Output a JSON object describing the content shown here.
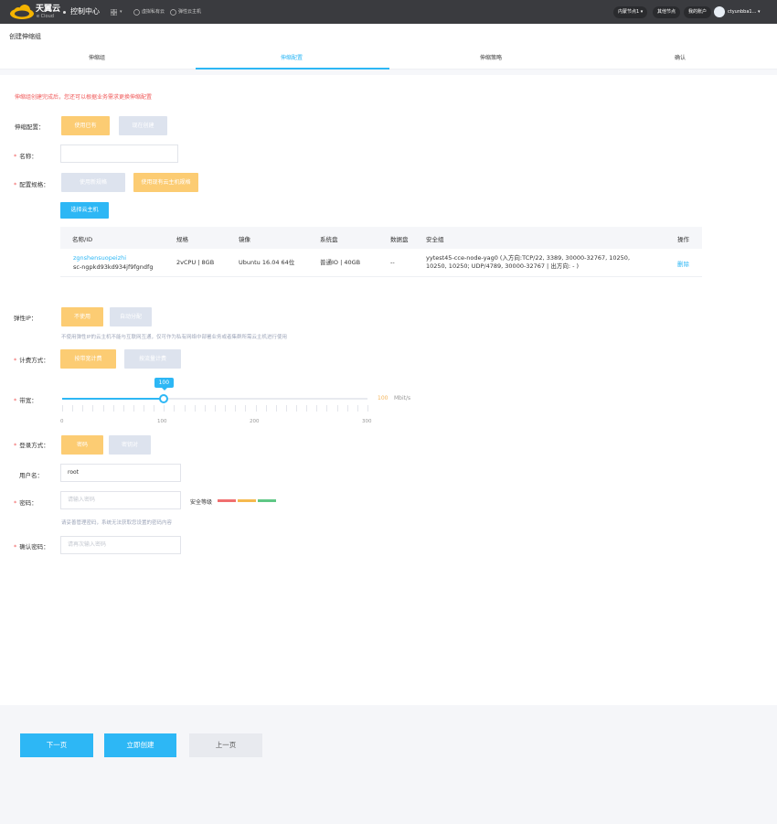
{
  "topbar": {
    "brand": "天翼云",
    "brand_sub": "e Cloud",
    "console": "控制中心",
    "links": [
      "虚拟私有云",
      "弹性云主机"
    ],
    "region": "内蒙节点1",
    "other_nodes": "其他节点",
    "my_account": "我的账户",
    "username": "ctyunbba1..."
  },
  "page": {
    "title": "创建伸缩组"
  },
  "steps": [
    "伸缩组",
    "伸缩配置",
    "伸缩策略",
    "确认"
  ],
  "notice": "伸缩组创建完成后，您还可以根据业务需求更换伸缩配置",
  "config": {
    "label": "伸缩配置：",
    "use_existing": "使用已有",
    "create_new": "现在创建"
  },
  "name": {
    "label": "名称：",
    "value": ""
  },
  "spec": {
    "label": "配置规格：",
    "use_new": "使用新规格",
    "use_existing_host": "使用现有云主机规格",
    "select_host": "选择云主机"
  },
  "table": {
    "headers": [
      "名称/ID",
      "规格",
      "镜像",
      "系统盘",
      "数据盘",
      "安全组",
      "操作"
    ],
    "rows": [
      {
        "name": "zgnshensuopeizhi",
        "id": "sc-ngpkd93kd934jf9fgndfg",
        "spec": "2vCPU | 8GB",
        "image": "Ubuntu 16.04 64位",
        "sysdisk": "普通IO | 40GB",
        "datadisk": "--",
        "secgroup_line1": "yytest45-cce-node-yag0 (入方向:TCP/22, 3389, 30000-32767, 10250,",
        "secgroup_line2": "10250, 10250; UDP/4789, 30000-32767 | 出方向: - )",
        "action": "删除"
      }
    ]
  },
  "eip": {
    "label": "弹性IP：",
    "not_use": "不使用",
    "auto": "自动分配",
    "hint": "不使用弹性IP的云主机不能与互联网互通，仅可作为私有网络中部署业务或者集群所需云主机进行使用"
  },
  "billing": {
    "label": "计费方式：",
    "by_bandwidth": "按带宽计费",
    "by_traffic": "按流量计费"
  },
  "bandwidth": {
    "label": "带宽：",
    "value": 100,
    "min": 0,
    "max": 300,
    "ticks": [
      "0",
      "100",
      "200",
      "300"
    ],
    "unit": "Mbit/s",
    "value_text": "100",
    "tooltip": "100"
  },
  "login": {
    "label": "登录方式：",
    "password": "密码",
    "keypair": "密钥对"
  },
  "username": {
    "label": "用户名：",
    "value": "root"
  },
  "password": {
    "label": "密码：",
    "placeholder": "请输入密码",
    "strength_label": "安全等级",
    "hint": "请妥善管理密码，系统无法获取您设置的密码内容"
  },
  "confirm": {
    "label": "确认密码：",
    "placeholder": "请再次输入密码"
  },
  "footer": {
    "next": "下一页",
    "create_now": "立即创建",
    "prev": "上一页"
  },
  "colors": {
    "accent": "#2db7f5",
    "orange": "#fccc73",
    "danger": "#f05b5b",
    "strength_weak": "#f06f6f",
    "strength_mid": "#f5b94e",
    "strength_strong": "#5fc785"
  }
}
